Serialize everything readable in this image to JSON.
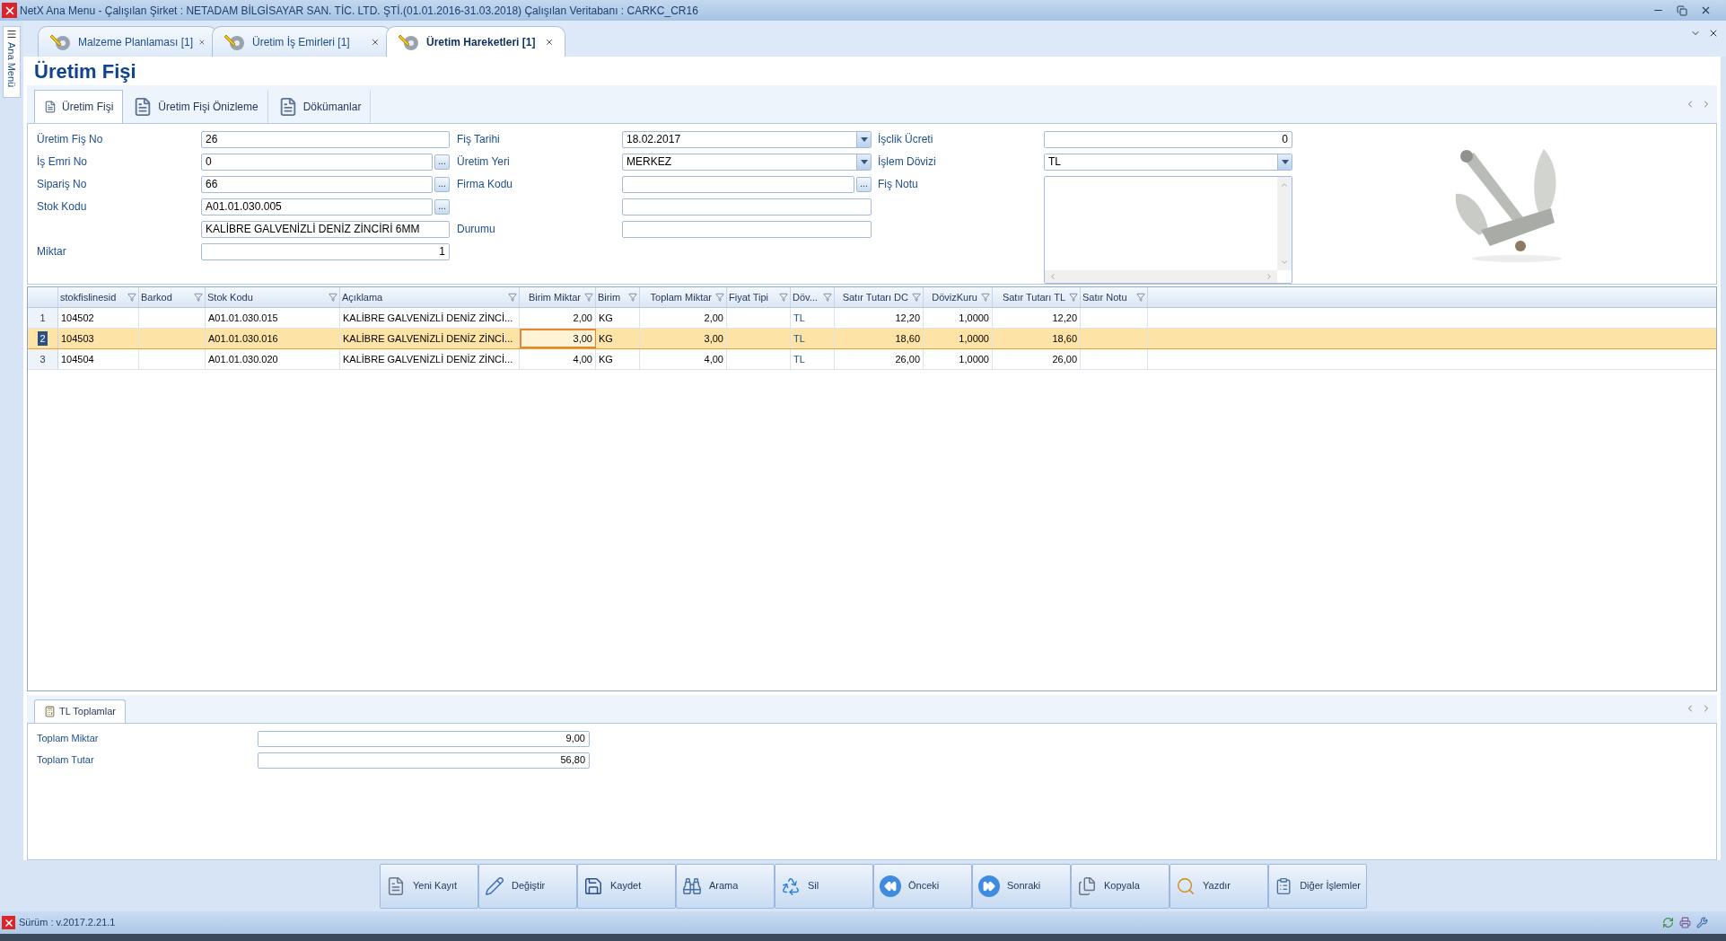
{
  "window": {
    "title": "NetX Ana Menu - Çalışılan Şirket : NETADAM BİLGİSAYAR SAN. TİC. LTD. ŞTİ.(01.01.2016-31.03.2018) Çalışılan Veritabanı : CARKC_CR16"
  },
  "side_panel": {
    "label": "Ana Menü"
  },
  "doc_tabs": [
    {
      "label": "Malzeme Planlaması [1]",
      "selected": false
    },
    {
      "label": "Üretim İş Emirleri [1]",
      "selected": false
    },
    {
      "label": "Üretim Hareketleri [1]",
      "selected": true
    }
  ],
  "page_title": "Üretim Fişi",
  "sub_tabs": [
    {
      "label": "Üretim Fişi",
      "selected": true
    },
    {
      "label": "Üretim Fişi Önizleme",
      "selected": false
    },
    {
      "label": "Dökümanlar",
      "selected": false
    }
  ],
  "form": {
    "columns": [
      [
        {
          "label": "Üretim Fiş No",
          "value": "26",
          "kind": "text"
        },
        {
          "label": "İş Emri No",
          "value": "0",
          "kind": "lookup",
          "button": "..."
        },
        {
          "label": "Sipariş No",
          "value": "66",
          "kind": "lookup",
          "button": "..."
        },
        {
          "label": "Stok Kodu",
          "value": "A01.01.030.005",
          "kind": "lookup",
          "button": "..."
        },
        {
          "value": "KALİBRE GALVENİZLİ DENİZ ZİNCİRİ  6MM",
          "kind": "text"
        },
        {
          "label": "Miktar",
          "value": "1",
          "kind": "number"
        }
      ],
      [
        {
          "label": "Fiş Tarihi",
          "value": "18.02.2017",
          "kind": "dropdown"
        },
        {
          "label": "Üretim Yeri",
          "value": "MERKEZ",
          "kind": "dropdown"
        },
        {
          "label": "Firma Kodu",
          "kind": "lookup",
          "button": "..."
        },
        {
          "kind": "text"
        },
        {
          "label": "Durumu",
          "kind": "text"
        }
      ],
      [
        {
          "label": "İşclik Ücreti",
          "value": "0",
          "kind": "number"
        },
        {
          "label": "İşlem Dövizi",
          "value": "TL",
          "kind": "dropdown"
        },
        {
          "label": "Fiş Notu",
          "kind": "memo"
        }
      ]
    ]
  },
  "grid": {
    "columns": [
      {
        "label": "stokfislinesid",
        "kind": "text",
        "focused": false
      },
      {
        "label": "Barkod",
        "kind": "text",
        "focused": false
      },
      {
        "label": "Stok Kodu",
        "kind": "text",
        "focused": false
      },
      {
        "label": "Açıklama",
        "kind": "text",
        "focused": false
      },
      {
        "label": "Birim Miktar",
        "kind": "number",
        "focused": true
      },
      {
        "label": "Birim",
        "kind": "text",
        "focused": false
      },
      {
        "label": "Toplam Miktar",
        "kind": "number",
        "focused": false
      },
      {
        "label": "Fiyat Tipi",
        "kind": "text",
        "focused": false
      },
      {
        "label": "Döv...",
        "kind": "code",
        "focused": false
      },
      {
        "label": "Satır Tutarı DC",
        "kind": "number",
        "focused": false
      },
      {
        "label": "DövizKuru",
        "kind": "number",
        "focused": false
      },
      {
        "label": "Satır Tutarı TL",
        "kind": "number",
        "focused": false
      },
      {
        "label": "Satır Notu",
        "kind": "text",
        "focused": false
      }
    ],
    "rows": [
      {
        "number": "1",
        "selected": false,
        "cells": [
          "104502",
          "",
          "A01.01.030.015",
          "KALİBRE GALVENİZLİ DENİZ ZİNCİ...",
          "2,00",
          "KG",
          "2,00",
          "",
          "TL",
          "12,20",
          "1,0000",
          "12,20",
          ""
        ]
      },
      {
        "number": "2",
        "selected": true,
        "cells": [
          "104503",
          "",
          "A01.01.030.016",
          "KALİBRE GALVENİZLİ DENİZ ZİNCİ...",
          "3,00",
          "KG",
          "3,00",
          "",
          "TL",
          "18,60",
          "1,0000",
          "18,60",
          ""
        ]
      },
      {
        "number": "3",
        "selected": false,
        "cells": [
          "104504",
          "",
          "A01.01.030.020",
          "KALİBRE GALVENİZLİ DENİZ ZİNCİ...",
          "4,00",
          "KG",
          "4,00",
          "",
          "TL",
          "26,00",
          "1,0000",
          "26,00",
          ""
        ]
      }
    ]
  },
  "totals": {
    "tab": "TL Toplamlar",
    "fields": [
      {
        "label": "Toplam Miktar",
        "value": "9,00"
      },
      {
        "label": "Toplam Tutar",
        "value": "56,80"
      }
    ]
  },
  "buttons": [
    {
      "label": "Yeni Kayıt",
      "kind": "new"
    },
    {
      "label": "Değiştir",
      "kind": "edit"
    },
    {
      "label": "Kaydet",
      "kind": "save"
    },
    {
      "label": "Arama",
      "kind": "search"
    },
    {
      "label": "Sil",
      "kind": "delete"
    },
    {
      "label": "Önceki",
      "kind": "prev"
    },
    {
      "label": "Sonraki",
      "kind": "next"
    },
    {
      "label": "Kopyala",
      "kind": "copy"
    },
    {
      "label": "Yazdır",
      "kind": "print"
    },
    {
      "label": "Diğer İşlemler",
      "kind": "other"
    }
  ],
  "status_bar": {
    "version": "Sürüm : v.2017.2.21.1"
  }
}
